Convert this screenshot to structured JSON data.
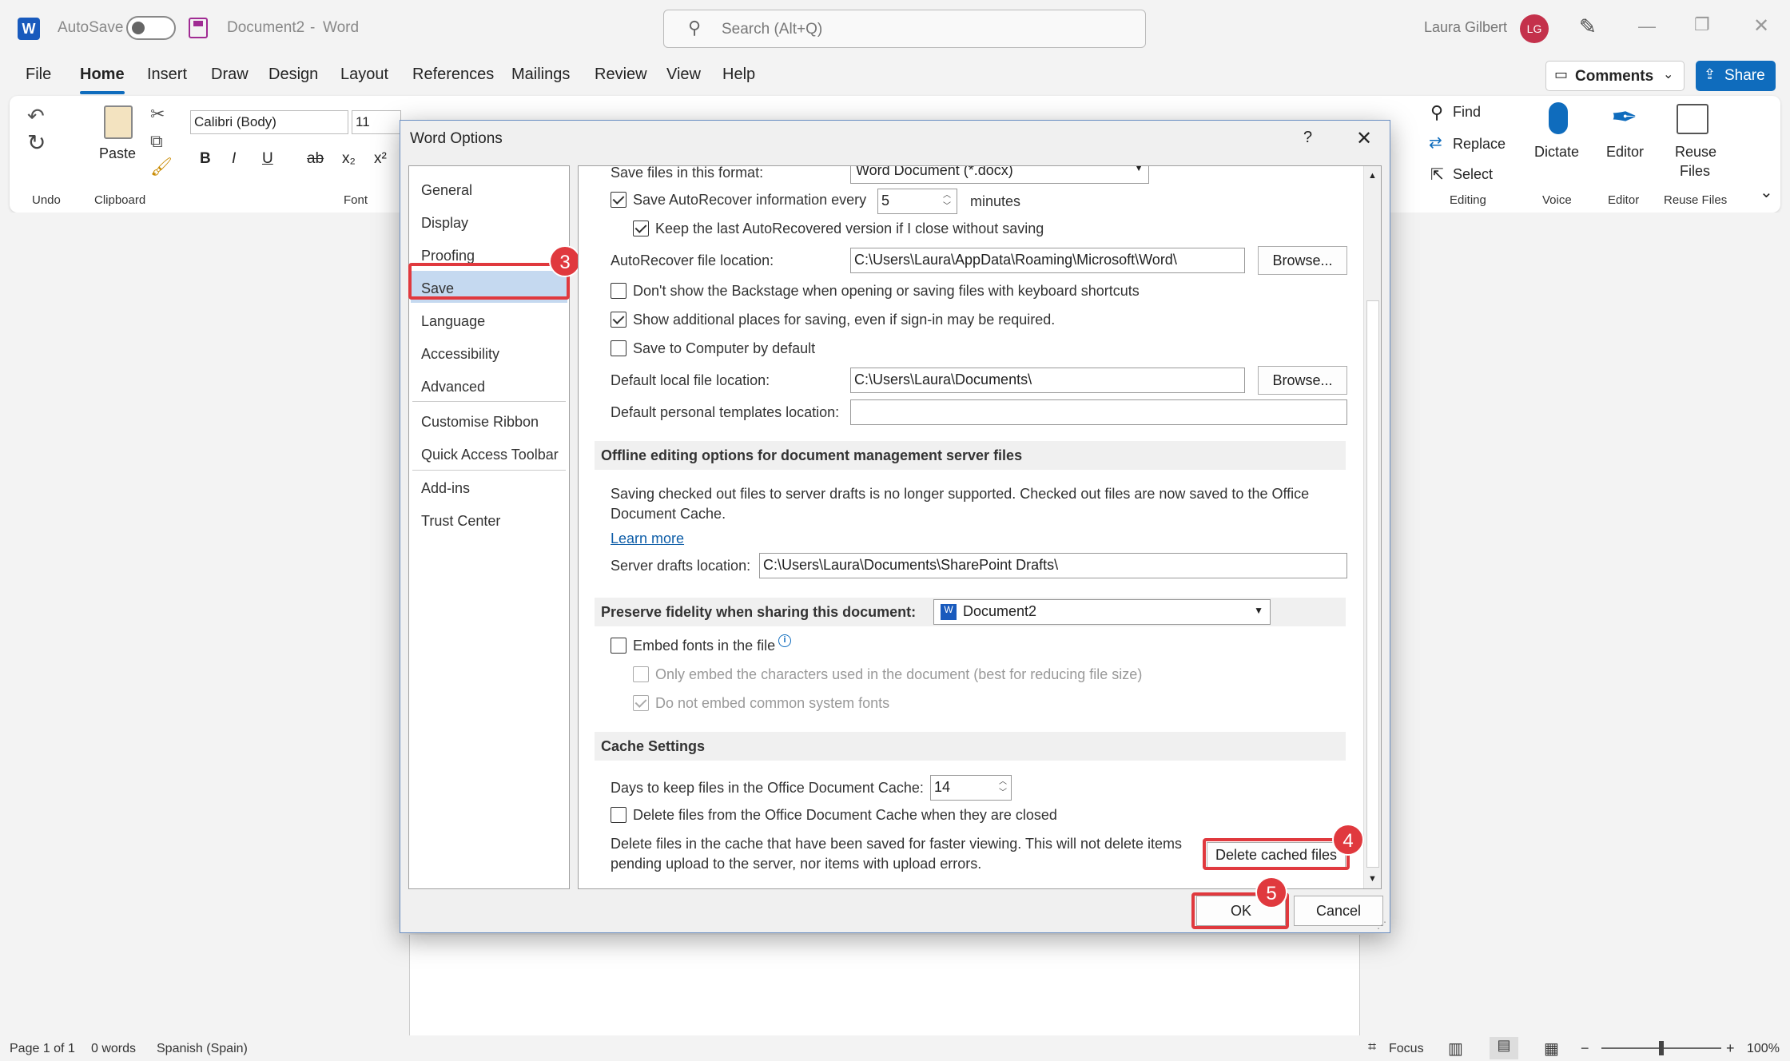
{
  "app": {
    "autosave_label": "AutoSave",
    "doc_title": "Document2",
    "dash": "-",
    "app_name": "Word",
    "search_placeholder": "Search (Alt+Q)",
    "user_name": "Laura  Gilbert",
    "user_initials": "LG"
  },
  "menu": {
    "items": [
      "File",
      "Home",
      "Insert",
      "Draw",
      "Design",
      "Layout",
      "References",
      "Mailings",
      "Review",
      "View",
      "Help"
    ],
    "comments_label": "Comments",
    "share_label": "Share"
  },
  "ribbon": {
    "undo_group": "Undo",
    "clipboard_group": "Clipboard",
    "paste_label": "Paste",
    "font_group": "Font",
    "font_name": "Calibri (Body)",
    "font_size": "11",
    "bold": "B",
    "italic": "I",
    "underline": "U",
    "strike": "ab",
    "sub": "x₂",
    "sup": "x²",
    "find": "Find",
    "replace": "Replace",
    "select": "Select",
    "editing_group": "Editing",
    "dictate": "Dictate",
    "voice_group": "Voice",
    "editor": "Editor",
    "editor_group": "Editor",
    "reuse_line1": "Reuse",
    "reuse_line2": "Files",
    "reuse_group": "Reuse Files"
  },
  "status": {
    "page": "Page 1 of 1",
    "words": "0 words",
    "language": "Spanish (Spain)",
    "focus": "Focus",
    "zoom": "100%",
    "minus": "−",
    "plus": "+"
  },
  "dialog": {
    "title": "Word Options",
    "help": "?",
    "nav": [
      "General",
      "Display",
      "Proofing",
      "Save",
      "Language",
      "Accessibility",
      "Advanced",
      "Customise Ribbon",
      "Quick Access Toolbar",
      "Add-ins",
      "Trust Center"
    ],
    "selected_nav": "Save",
    "save": {
      "format_label": "Save files in this format:",
      "format_value": "Word Document (*.docx)",
      "autorecover_label": "Save AutoRecover information every",
      "autorecover_value": "5",
      "minutes": "minutes",
      "keep_last": "Keep the last AutoRecovered version if I close without saving",
      "ar_location_label": "AutoRecover file location:",
      "ar_location_value": "C:\\Users\\Laura\\AppData\\Roaming\\Microsoft\\Word\\",
      "browse": "Browse...",
      "no_backstage": "Don't show the Backstage when opening or saving files with keyboard shortcuts",
      "show_places": "Show additional places for saving, even if sign-in may be required.",
      "save_computer": "Save to Computer by default",
      "local_location_label": "Default local file location:",
      "local_location_value": "C:\\Users\\Laura\\Documents\\",
      "templates_label": "Default personal templates location:",
      "templates_value": ""
    },
    "offline": {
      "header": "Offline editing options for document management server files",
      "note_line1": "Saving checked out files to server drafts is no longer supported. Checked out files are now saved to the Office",
      "note_line2": "Document Cache.",
      "learn_more": "Learn more",
      "drafts_label": "Server drafts location:",
      "drafts_value": "C:\\Users\\Laura\\Documents\\SharePoint Drafts\\"
    },
    "fidelity": {
      "header": "Preserve fidelity when sharing this document:",
      "doc_value": "Document2",
      "embed": "Embed fonts in the file",
      "embed_chars": "Only embed the characters used in the document (best for reducing file size)",
      "no_common": "Do not embed common system fonts"
    },
    "cache": {
      "header": "Cache Settings",
      "days_label": "Days to keep files in the Office Document Cache:",
      "days_value": "14",
      "delete_closed": "Delete files from the Office Document Cache when they are closed",
      "delete_note_line1": "Delete files in the cache that have been saved for faster viewing. This will not delete items",
      "delete_note_line2": "pending upload to the server, nor items with upload errors.",
      "delete_button": "Delete cached files"
    },
    "ok": "OK",
    "cancel": "Cancel"
  },
  "callouts": {
    "n3": "3",
    "n4": "4",
    "n5": "5"
  },
  "colors": {
    "accent": "#0f6cbd",
    "callout": "#e0393e",
    "avatar": "#c4314b",
    "word_blue": "#185abd",
    "autosave_purple": "#a02b93"
  }
}
